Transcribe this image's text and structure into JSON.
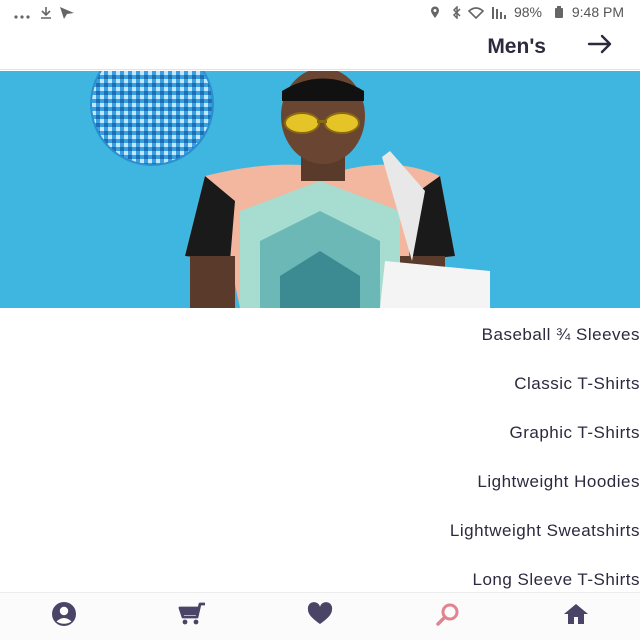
{
  "status_bar": {
    "time": "9:48 PM",
    "battery": "98%",
    "icons": [
      "location-icon",
      "bluetooth-icon",
      "wifi-icon",
      "signal-icon",
      "battery-icon",
      "send-icon",
      "download-icon",
      "more-icon"
    ]
  },
  "header": {
    "title": "Men's",
    "back_icon": "arrow-back-icon"
  },
  "hero": {
    "description": ""
  },
  "categories": [
    {
      "label": "Baseball ¾ Sleeves"
    },
    {
      "label": "Classic T-Shirts"
    },
    {
      "label": "Graphic T-Shirts"
    },
    {
      "label": "Lightweight Hoodies"
    },
    {
      "label": "Lightweight Sweatshirts"
    },
    {
      "label": "Long Sleeve T-Shirts"
    }
  ],
  "bottom_nav": {
    "items": [
      {
        "icon": "home-icon",
        "color": "#4a4466"
      },
      {
        "icon": "search-icon",
        "color": "#e2848f"
      },
      {
        "icon": "heart-icon",
        "color": "#4a4466"
      },
      {
        "icon": "cart-icon",
        "color": "#4a4466"
      },
      {
        "icon": "account-icon",
        "color": "#4a4466"
      }
    ]
  },
  "colors": {
    "accent": "#e2848f",
    "text": "#2c2a3e",
    "hero_bg": "#3fb6df"
  }
}
